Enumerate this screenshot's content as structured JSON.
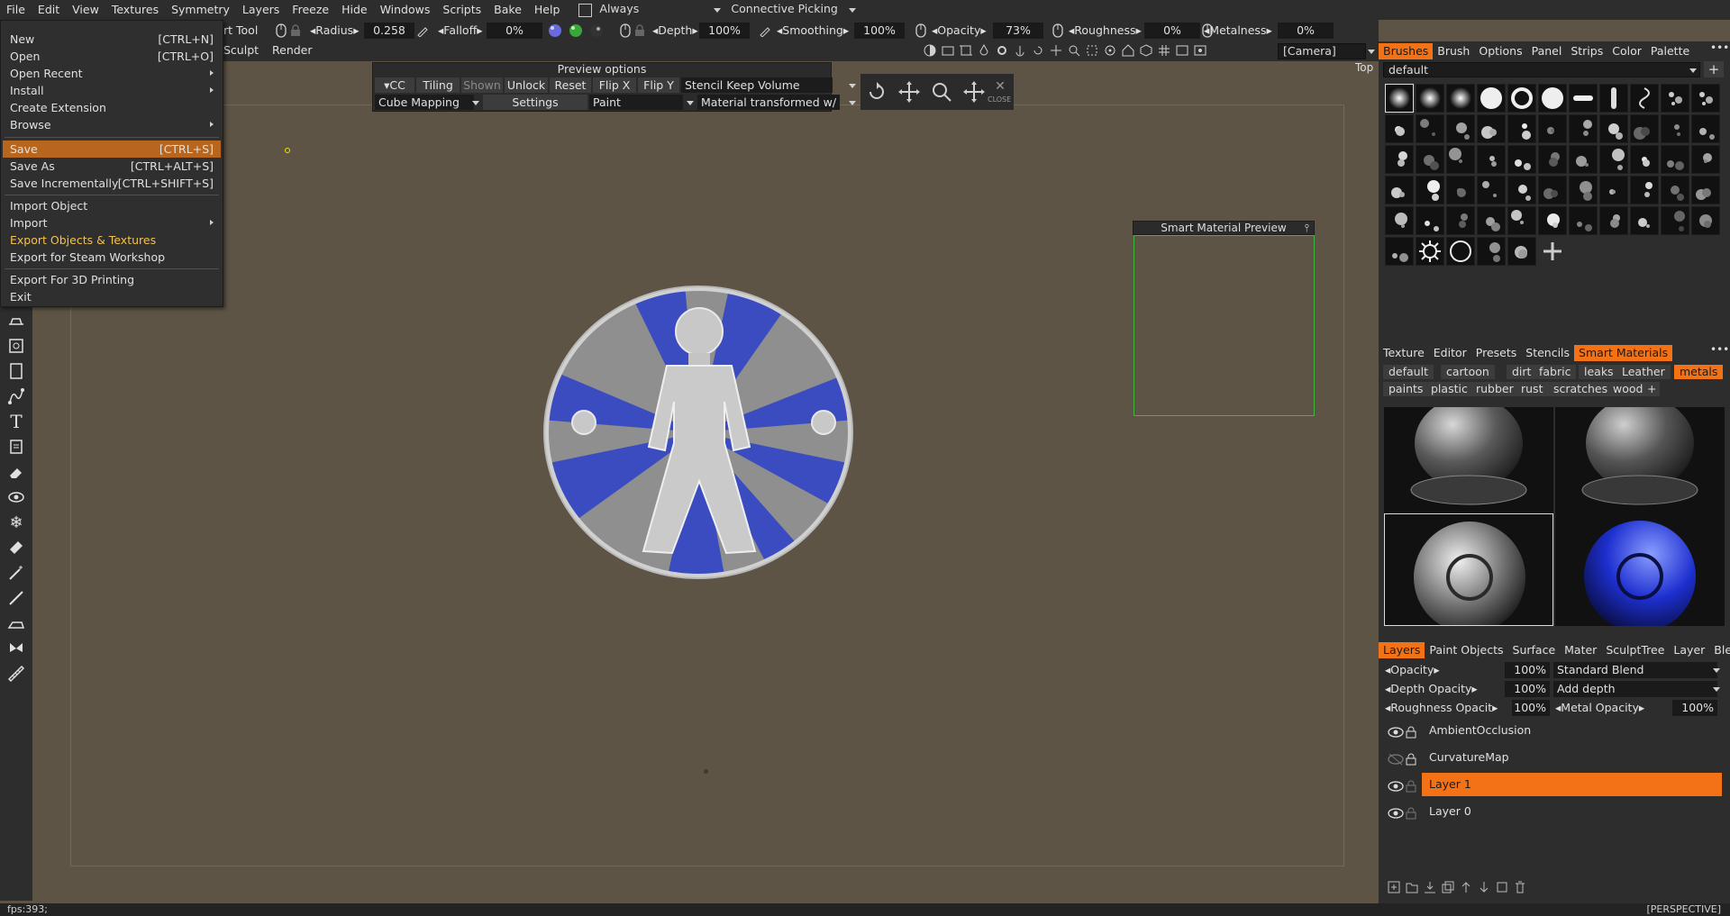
{
  "menubar": {
    "items": [
      "File",
      "Edit",
      "View",
      "Textures",
      "Symmetry",
      "Layers",
      "Freeze",
      "Hide",
      "Windows",
      "Scripts",
      "Bake",
      "Help"
    ],
    "always_label": "Always",
    "picking_label": "Connective Picking"
  },
  "toolbar": {
    "tool_label": "rt Tool",
    "radius_label": "Radius",
    "radius_value": "0.258",
    "falloff_label": "Falloff",
    "falloff_value": "0%",
    "depth_label": "Depth",
    "depth_value": "100%",
    "smoothing_label": "Smoothing",
    "smoothing_value": "100%",
    "opacity_label": "Opacity",
    "opacity_value": "73%",
    "roughness_label": "Roughness",
    "roughness_value": "0%",
    "metalness_label": "Metalness",
    "metalness_value": "0%",
    "sculpt_label": "Sculpt",
    "render_label": "Render",
    "camera_label": "[Camera]"
  },
  "file_menu": {
    "items": [
      {
        "label": "New",
        "shortcut": "[CTRL+N]"
      },
      {
        "label": "Open",
        "shortcut": "[CTRL+O]"
      },
      {
        "label": "Open Recent",
        "submenu": true
      },
      {
        "label": "Install",
        "submenu": true
      },
      {
        "label": "Create Extension"
      },
      {
        "label": "Browse",
        "submenu": true
      },
      {
        "label": "Save",
        "shortcut": "[CTRL+S]",
        "highlighted": true
      },
      {
        "label": "Save As",
        "shortcut": "[CTRL+ALT+S]"
      },
      {
        "label": "Save Incrementally",
        "shortcut": "[CTRL+SHIFT+S]"
      },
      {
        "label": "Import Object"
      },
      {
        "label": "Import",
        "submenu": true
      },
      {
        "label": "Export Objects & Textures",
        "accent": true
      },
      {
        "label": "Export for Steam Workshop"
      },
      {
        "label": "Export For 3D Printing"
      },
      {
        "label": "Exit"
      }
    ]
  },
  "preview_options": {
    "title": "Preview options",
    "cc": "CC",
    "tiling": "Tiling",
    "shown": "Shown",
    "unlock": "Unlock",
    "reset": "Reset",
    "flip_x": "Flip X",
    "flip_y": "Flip Y",
    "stencil_mode": "Stencil Keep Volume",
    "mapping": "Cube Mapping",
    "settings": "Settings",
    "paint": "Paint",
    "material_mode": "Material transformed w/",
    "close": "CLOSE"
  },
  "viewport": {
    "top_label": "Top",
    "smart_material_preview": "Smart Material Preview",
    "projection": "[PERSPECTIVE]",
    "fps": "fps:393;"
  },
  "brushes_panel": {
    "tabs": [
      "Brushes",
      "Brush",
      "Options",
      "Panel",
      "Strips",
      "Color",
      "Palette"
    ],
    "active_tab": "Brushes",
    "preset": "default",
    "add": "+"
  },
  "smart_materials": {
    "tabs": [
      "Texture",
      "Editor",
      "Presets",
      "Stencils",
      "Smart Materials"
    ],
    "active_tab": "Smart Materials",
    "tags_row1": [
      "default",
      "cartoon",
      "dirt",
      "fabric",
      "leaks",
      "Leather",
      "metals"
    ],
    "tags_row2": [
      "paints",
      "plastic",
      "rubber",
      "rust",
      "scratches",
      "wood",
      "+"
    ],
    "active_tag": "metals"
  },
  "layers_panel": {
    "tabs": [
      "Layers",
      "Paint Objects",
      "Surface",
      "Mater",
      "SculptTree",
      "Layer",
      "Blendin"
    ],
    "active_tab": "Layers",
    "opacity_label": "Opacity",
    "opacity_value": "100%",
    "blend_mode": "Standard Blend",
    "depth_opacity_label": "Depth Opacity",
    "depth_opacity_value": "100%",
    "depth_mode": "Add depth",
    "roughness_opacity_label": "Roughness Opacit",
    "roughness_opacity_value": "100%",
    "metal_opacity_label": "Metal Opacity",
    "metal_opacity_value": "100%",
    "layers": [
      {
        "name": "AmbientOcclusion",
        "visible": true,
        "active": false
      },
      {
        "name": "CurvatureMap",
        "visible": false,
        "active": false
      },
      {
        "name": "Layer 1",
        "visible": true,
        "active": true
      },
      {
        "name": "Layer 0",
        "visible": true,
        "active": false
      }
    ]
  },
  "colors": {
    "accent": "#f47216",
    "viewport_bg": "#5d5445",
    "panel_bg": "#2d2d2d",
    "badge_blue": "#3a4cc0",
    "badge_gray": "#8f8f8f"
  }
}
